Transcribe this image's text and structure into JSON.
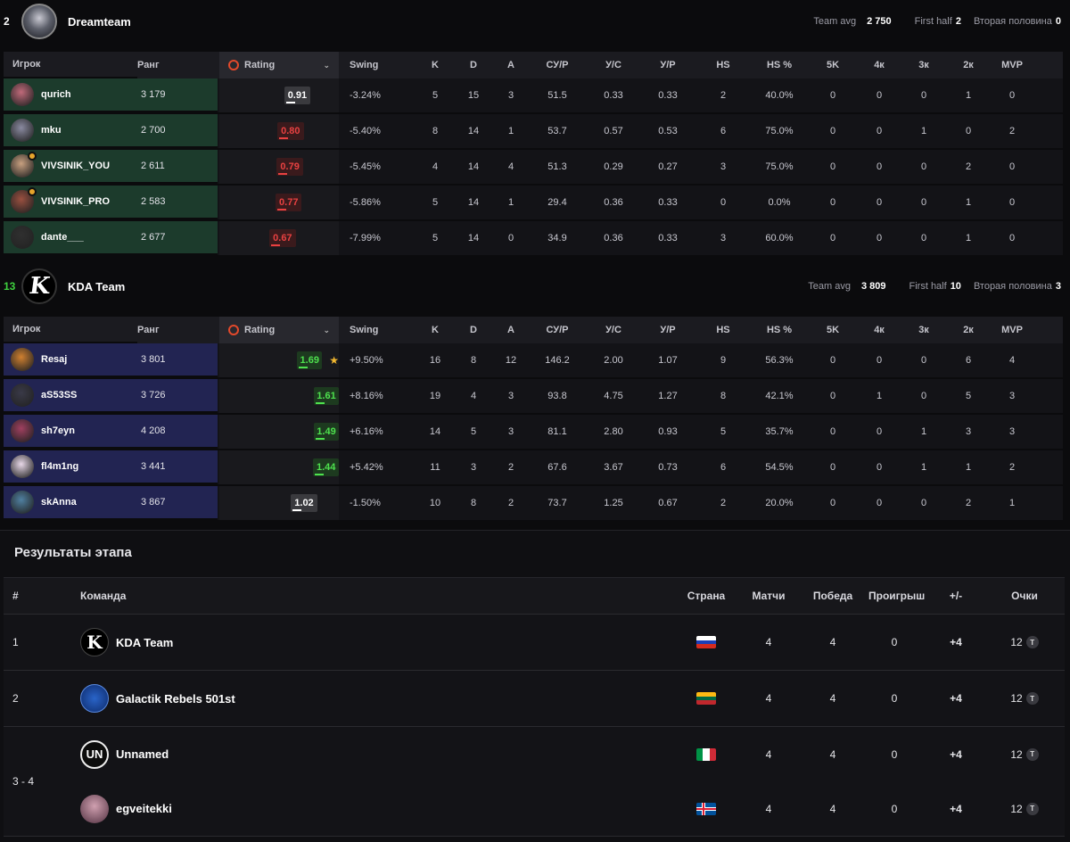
{
  "teams": [
    {
      "score": "2",
      "name": "Dreamteam",
      "team_avg_label": "Team avg",
      "team_avg": "2 750",
      "first_half_label": "First half",
      "first_half": "2",
      "second_half_label": "Вторая половина",
      "second_half": "0",
      "headers": {
        "player": "Игрок",
        "rank": "Ранг",
        "rating": "Rating",
        "swing": "Swing",
        "k": "K",
        "d": "D",
        "a": "A",
        "adr": "СУ/Р",
        "kd": "У/С",
        "kr": "У/Р",
        "hs": "HS",
        "hsp": "HS %",
        "k5": "5K",
        "k4": "4к",
        "k3": "3к",
        "k2": "2к",
        "mvp": "MVP"
      },
      "players": [
        {
          "name": "qurich",
          "rank": "3 179",
          "rating": "0.91",
          "rating_value": 0.91,
          "rating_color": "grey",
          "swing": "-3.24%",
          "k": "5",
          "d": "15",
          "a": "3",
          "adr": "51.5",
          "kd": "0.33",
          "kr": "0.33",
          "hs": "2",
          "hsp": "40.0%",
          "k5": "0",
          "k4": "0",
          "k3": "0",
          "k2": "1",
          "mvp": "0",
          "avatar_color": "#c06a7a",
          "medal": false
        },
        {
          "name": "mku",
          "rank": "2 700",
          "rating": "0.80",
          "rating_value": 0.8,
          "rating_color": "red",
          "swing": "-5.40%",
          "k": "8",
          "d": "14",
          "a": "1",
          "adr": "53.7",
          "kd": "0.57",
          "kr": "0.53",
          "hs": "6",
          "hsp": "75.0%",
          "k5": "0",
          "k4": "0",
          "k3": "1",
          "k2": "0",
          "mvp": "2",
          "avatar_color": "#8a8aa0",
          "medal": false
        },
        {
          "name": "VIVSINIK_YOU",
          "rank": "2 611",
          "rating": "0.79",
          "rating_value": 0.79,
          "rating_color": "red",
          "swing": "-5.45%",
          "k": "4",
          "d": "14",
          "a": "4",
          "adr": "51.3",
          "kd": "0.29",
          "kr": "0.27",
          "hs": "3",
          "hsp": "75.0%",
          "k5": "0",
          "k4": "0",
          "k3": "0",
          "k2": "2",
          "mvp": "0",
          "avatar_color": "#c8a080",
          "medal": true
        },
        {
          "name": "VIVSINIK_PRO",
          "rank": "2 583",
          "rating": "0.77",
          "rating_value": 0.77,
          "rating_color": "red",
          "swing": "-5.86%",
          "k": "5",
          "d": "14",
          "a": "1",
          "adr": "29.4",
          "kd": "0.36",
          "kr": "0.33",
          "hs": "0",
          "hsp": "0.0%",
          "k5": "0",
          "k4": "0",
          "k3": "0",
          "k2": "1",
          "mvp": "0",
          "avatar_color": "#9a5040",
          "medal": true
        },
        {
          "name": "dante___",
          "rank": "2 677",
          "rating": "0.67",
          "rating_value": 0.67,
          "rating_color": "red",
          "swing": "-7.99%",
          "k": "5",
          "d": "14",
          "a": "0",
          "adr": "34.9",
          "kd": "0.36",
          "kr": "0.33",
          "hs": "3",
          "hsp": "60.0%",
          "k5": "0",
          "k4": "0",
          "k3": "0",
          "k2": "1",
          "mvp": "0",
          "avatar_color": "#303030",
          "medal": false
        }
      ]
    },
    {
      "score": "13",
      "name": "KDA Team",
      "team_avg_label": "Team avg",
      "team_avg": "3 809",
      "first_half_label": "First half",
      "first_half": "10",
      "second_half_label": "Вторая половина",
      "second_half": "3",
      "headers": {
        "player": "Игрок",
        "rank": "Ранг",
        "rating": "Rating",
        "swing": "Swing",
        "k": "K",
        "d": "D",
        "a": "A",
        "adr": "СУ/Р",
        "kd": "У/С",
        "kr": "У/Р",
        "hs": "HS",
        "hsp": "HS %",
        "k5": "5K",
        "k4": "4к",
        "k3": "3к",
        "k2": "2к",
        "mvp": "MVP"
      },
      "players": [
        {
          "name": "Resaj",
          "rank": "3 801",
          "rating": "1.69",
          "rating_value": 1.69,
          "rating_color": "green",
          "star": "★",
          "swing": "+9.50%",
          "k": "16",
          "d": "8",
          "a": "12",
          "adr": "146.2",
          "kd": "2.00",
          "kr": "1.07",
          "hs": "9",
          "hsp": "56.3%",
          "k5": "0",
          "k4": "0",
          "k3": "0",
          "k2": "6",
          "mvp": "4",
          "avatar_color": "#d08030",
          "medal": false
        },
        {
          "name": "aS53SS",
          "rank": "3 726",
          "rating": "1.61",
          "rating_value": 1.61,
          "rating_color": "green",
          "swing": "+8.16%",
          "k": "19",
          "d": "4",
          "a": "3",
          "adr": "93.8",
          "kd": "4.75",
          "kr": "1.27",
          "hs": "8",
          "hsp": "42.1%",
          "k5": "0",
          "k4": "1",
          "k3": "0",
          "k2": "5",
          "mvp": "3",
          "avatar_color": "#3a3a48",
          "medal": false
        },
        {
          "name": "sh7eyn",
          "rank": "4 208",
          "rating": "1.49",
          "rating_value": 1.49,
          "rating_color": "green",
          "swing": "+6.16%",
          "k": "14",
          "d": "5",
          "a": "3",
          "adr": "81.1",
          "kd": "2.80",
          "kr": "0.93",
          "hs": "5",
          "hsp": "35.7%",
          "k5": "0",
          "k4": "0",
          "k3": "1",
          "k2": "3",
          "mvp": "3",
          "avatar_color": "#a04060",
          "medal": false
        },
        {
          "name": "fl4m1ng",
          "rank": "3 441",
          "rating": "1.44",
          "rating_value": 1.44,
          "rating_color": "green",
          "swing": "+5.42%",
          "k": "11",
          "d": "3",
          "a": "2",
          "adr": "67.6",
          "kd": "3.67",
          "kr": "0.73",
          "hs": "6",
          "hsp": "54.5%",
          "k5": "0",
          "k4": "0",
          "k3": "1",
          "k2": "1",
          "mvp": "2",
          "avatar_color": "#e8d8e8",
          "medal": false
        },
        {
          "name": "skAnna",
          "rank": "3 867",
          "rating": "1.02",
          "rating_value": 1.02,
          "rating_color": "grey",
          "swing": "-1.50%",
          "k": "10",
          "d": "8",
          "a": "2",
          "adr": "73.7",
          "kd": "1.25",
          "kr": "0.67",
          "hs": "2",
          "hsp": "20.0%",
          "k5": "0",
          "k4": "0",
          "k3": "0",
          "k2": "2",
          "mvp": "1",
          "avatar_color": "#5080a0",
          "medal": false
        }
      ]
    }
  ],
  "results": {
    "title": "Результаты этапа",
    "headers": {
      "pos": "#",
      "team": "Команда",
      "country": "Страна",
      "matches": "Матчи",
      "wins": "Победа",
      "losses": "Проигрыш",
      "diff": "+/-",
      "points": "Очки"
    },
    "rows": [
      {
        "pos": "1",
        "team": "KDA Team",
        "logo": "kda-logo",
        "flag": "russia",
        "matches": "4",
        "wins": "4",
        "losses": "0",
        "diff": "+4",
        "points": "12",
        "badge": "T"
      },
      {
        "pos": "2",
        "team": "Galactik Rebels 501st",
        "logo": "galactik-logo",
        "flag": "lithuania",
        "matches": "4",
        "wins": "4",
        "losses": "0",
        "diff": "+4",
        "points": "12",
        "badge": "T"
      }
    ],
    "group": {
      "pos": "3 - 4",
      "rows": [
        {
          "team": "Unnamed",
          "logo": "unnamed-logo",
          "flag": "italy",
          "matches": "4",
          "wins": "4",
          "losses": "0",
          "diff": "+4",
          "points": "12",
          "badge": "T"
        },
        {
          "team": "egveitekki",
          "logo": "egveitekki-avatar",
          "flag": "iceland",
          "matches": "4",
          "wins": "4",
          "losses": "0",
          "diff": "+4",
          "points": "12",
          "badge": "T"
        }
      ]
    }
  },
  "colors": {
    "accent_orange": "#e2492b",
    "green": "#3fe03f",
    "red": "#e84141",
    "team_a_row": "#1c3b2c",
    "team_b_row": "#222452"
  }
}
